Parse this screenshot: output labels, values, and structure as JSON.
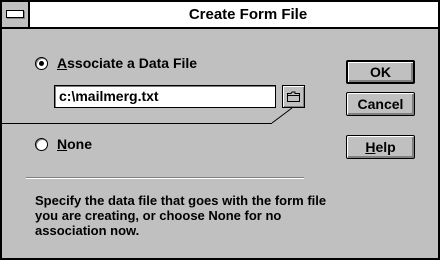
{
  "dialog": {
    "title": "Create Form File"
  },
  "options": {
    "associate": {
      "label_hot": "A",
      "label_rest": "ssociate a Data File",
      "selected": true
    },
    "none": {
      "label_hot": "N",
      "label_rest": "one",
      "selected": false
    }
  },
  "data_file": {
    "value": "c:\\mailmerg.txt"
  },
  "buttons": {
    "ok": "OK",
    "cancel": "Cancel",
    "help_hot": "H",
    "help_rest": "elp"
  },
  "description": "Specify the data file that goes with the form file you are creating, or choose None for no association now."
}
